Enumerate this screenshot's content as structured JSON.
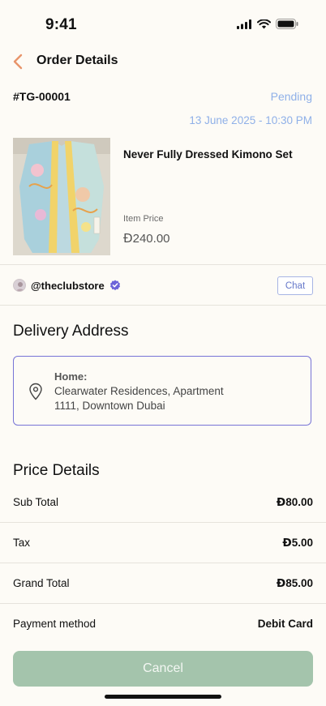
{
  "status_bar": {
    "time": "9:41"
  },
  "header": {
    "title": "Order Details"
  },
  "order": {
    "id": "#TG-00001",
    "status": "Pending",
    "date": "13 June 2025 - 10:30 PM"
  },
  "product": {
    "name": "Never Fully Dressed Kimono Set",
    "price_label": "Item Price",
    "currency_symbol": "Đ",
    "price": "240.00"
  },
  "store": {
    "name": "@theclubstore",
    "chat_label": "Chat"
  },
  "delivery": {
    "title": "Delivery Address",
    "label": "Home:",
    "line1": "Clearwater Residences, Apartment",
    "line2": "1111, Downtown Dubai"
  },
  "price_details": {
    "title": "Price Details",
    "rows": [
      {
        "label": "Sub Total",
        "currency": "Đ",
        "value": "80.00"
      },
      {
        "label": "Tax",
        "currency": "Đ",
        "value": "5.00"
      },
      {
        "label": "Grand Total",
        "currency": "Đ",
        "value": "85.00"
      },
      {
        "label": "Payment method",
        "currency": "",
        "value": "Debit Card"
      }
    ]
  },
  "actions": {
    "cancel_label": "Cancel"
  },
  "colors": {
    "accent_back": "#e8946a",
    "status_blue": "#8fb0e8",
    "card_border": "#7774d6",
    "cancel_bg": "#a4c4ac",
    "verified": "#6c63d8"
  }
}
